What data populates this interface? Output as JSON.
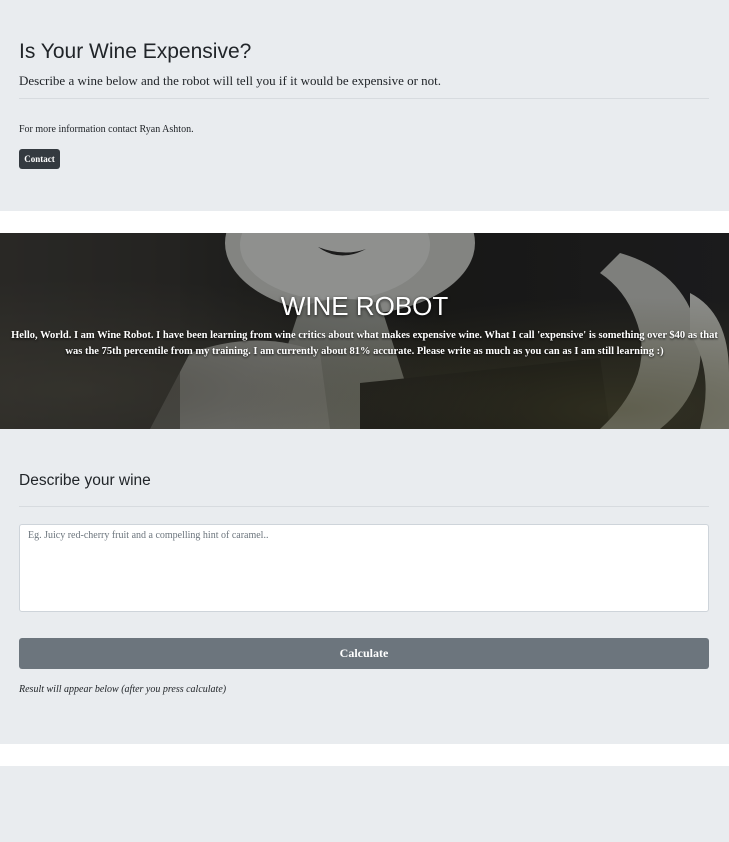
{
  "header": {
    "title": "Is Your Wine Expensive?",
    "lead": "Describe a wine below and the robot will tell you if it would be expensive or not.",
    "info": "For more information contact Ryan Ashton.",
    "contact_label": "Contact"
  },
  "hero": {
    "title": "WINE ROBOT",
    "text": "Hello, World. I am Wine Robot. I have been learning from wine critics about what makes expensive wine. What I call 'expensive' is something over $40 as that was the 75th percentile from my training. I am currently about 81% accurate. Please write as much as you can as I am still learning :)"
  },
  "form": {
    "heading": "Describe your wine",
    "placeholder": "Eg. Juicy red-cherry fruit and a compelling hint of caramel..",
    "calculate_label": "Calculate",
    "result_text": "Result will appear below (after you press calculate)"
  },
  "colors": {
    "section_bg": "#e9ecef",
    "contact_button": "#343a40",
    "calculate_button": "#6c757d"
  }
}
